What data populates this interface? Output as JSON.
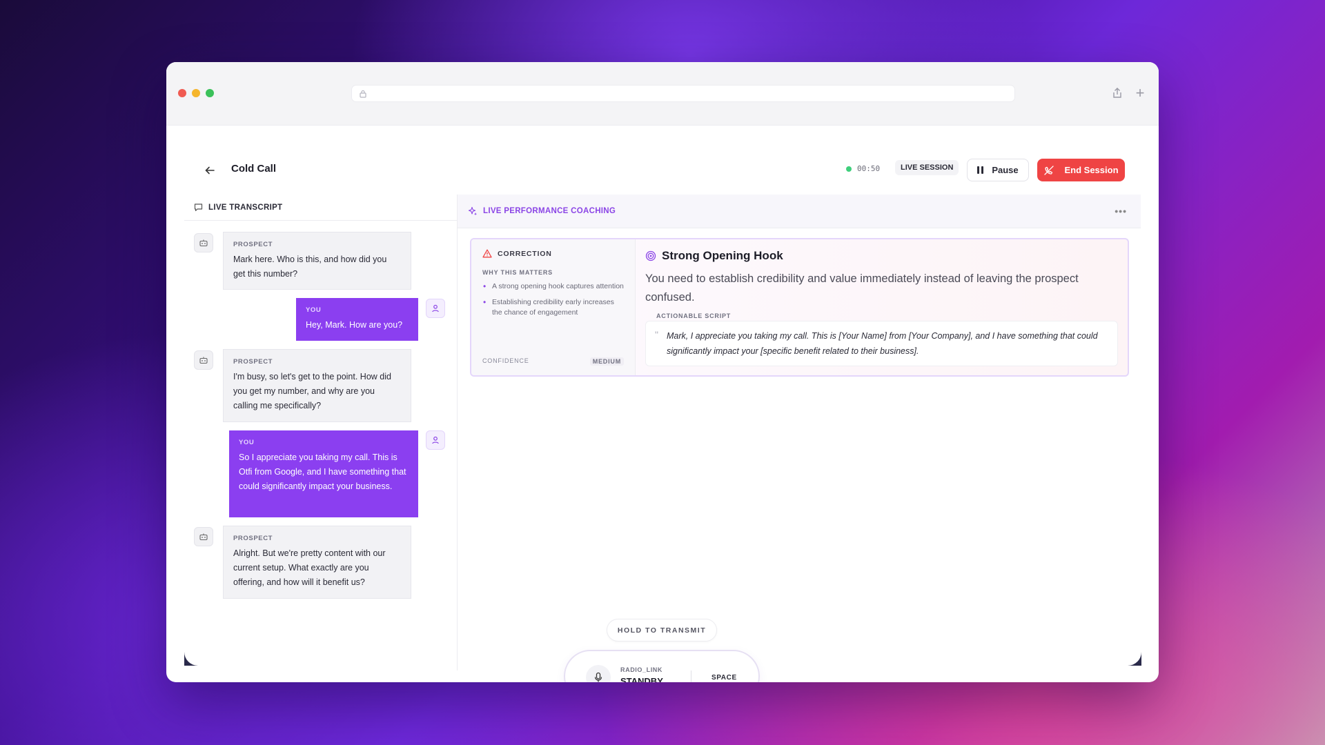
{
  "header": {
    "title": "Cold Call",
    "timer": "00:50",
    "badge": "LIVE SESSION",
    "pause_label": "Pause",
    "end_label": "End Session"
  },
  "transcript": {
    "heading": "LIVE TRANSCRIPT",
    "messages": [
      {
        "speaker": "PROSPECT",
        "text": "Mark here. Who is this, and how did you get this number?"
      },
      {
        "speaker": "YOU",
        "text": "Hey, Mark. How are you?"
      },
      {
        "speaker": "PROSPECT",
        "text": "I'm busy, so let's get to the point. How did you get my number, and why are you calling me specifically?"
      },
      {
        "speaker": "YOU",
        "text": "So I appreciate you taking my call. This is Otfi from Google, and I have something that could significantly impact your business."
      },
      {
        "speaker": "PROSPECT",
        "text": "Alright. But we're pretty content with our current setup. What exactly are you offering, and how will it benefit us?"
      }
    ]
  },
  "coaching": {
    "heading": "LIVE PERFORMANCE COACHING",
    "card": {
      "type": "CORRECTION",
      "why_label": "WHY THIS MATTERS",
      "reasons": [
        "A strong opening hook captures attention",
        "Establishing credibility early increases the chance of engagement"
      ],
      "confidence_label": "CONFIDENCE",
      "confidence_value": "MEDIUM",
      "title": "Strong Opening Hook",
      "description": "You need to establish credibility and value immediately instead of leaving the prospect confused.",
      "script_label": "ACTIONABLE SCRIPT",
      "script": "Mark, I appreciate you taking my call. This is [Your Name] from [Your Company], and I have something that could significantly impact your [specific benefit related to their business]."
    }
  },
  "radio": {
    "hold_label": "HOLD TO TRANSMIT",
    "channel": "RADIO_LINK",
    "status": "STANDBY",
    "key": "SPACE"
  },
  "colors": {
    "accent": "#8b3ff0",
    "danger": "#ef4444",
    "live": "#3fcf7c"
  }
}
